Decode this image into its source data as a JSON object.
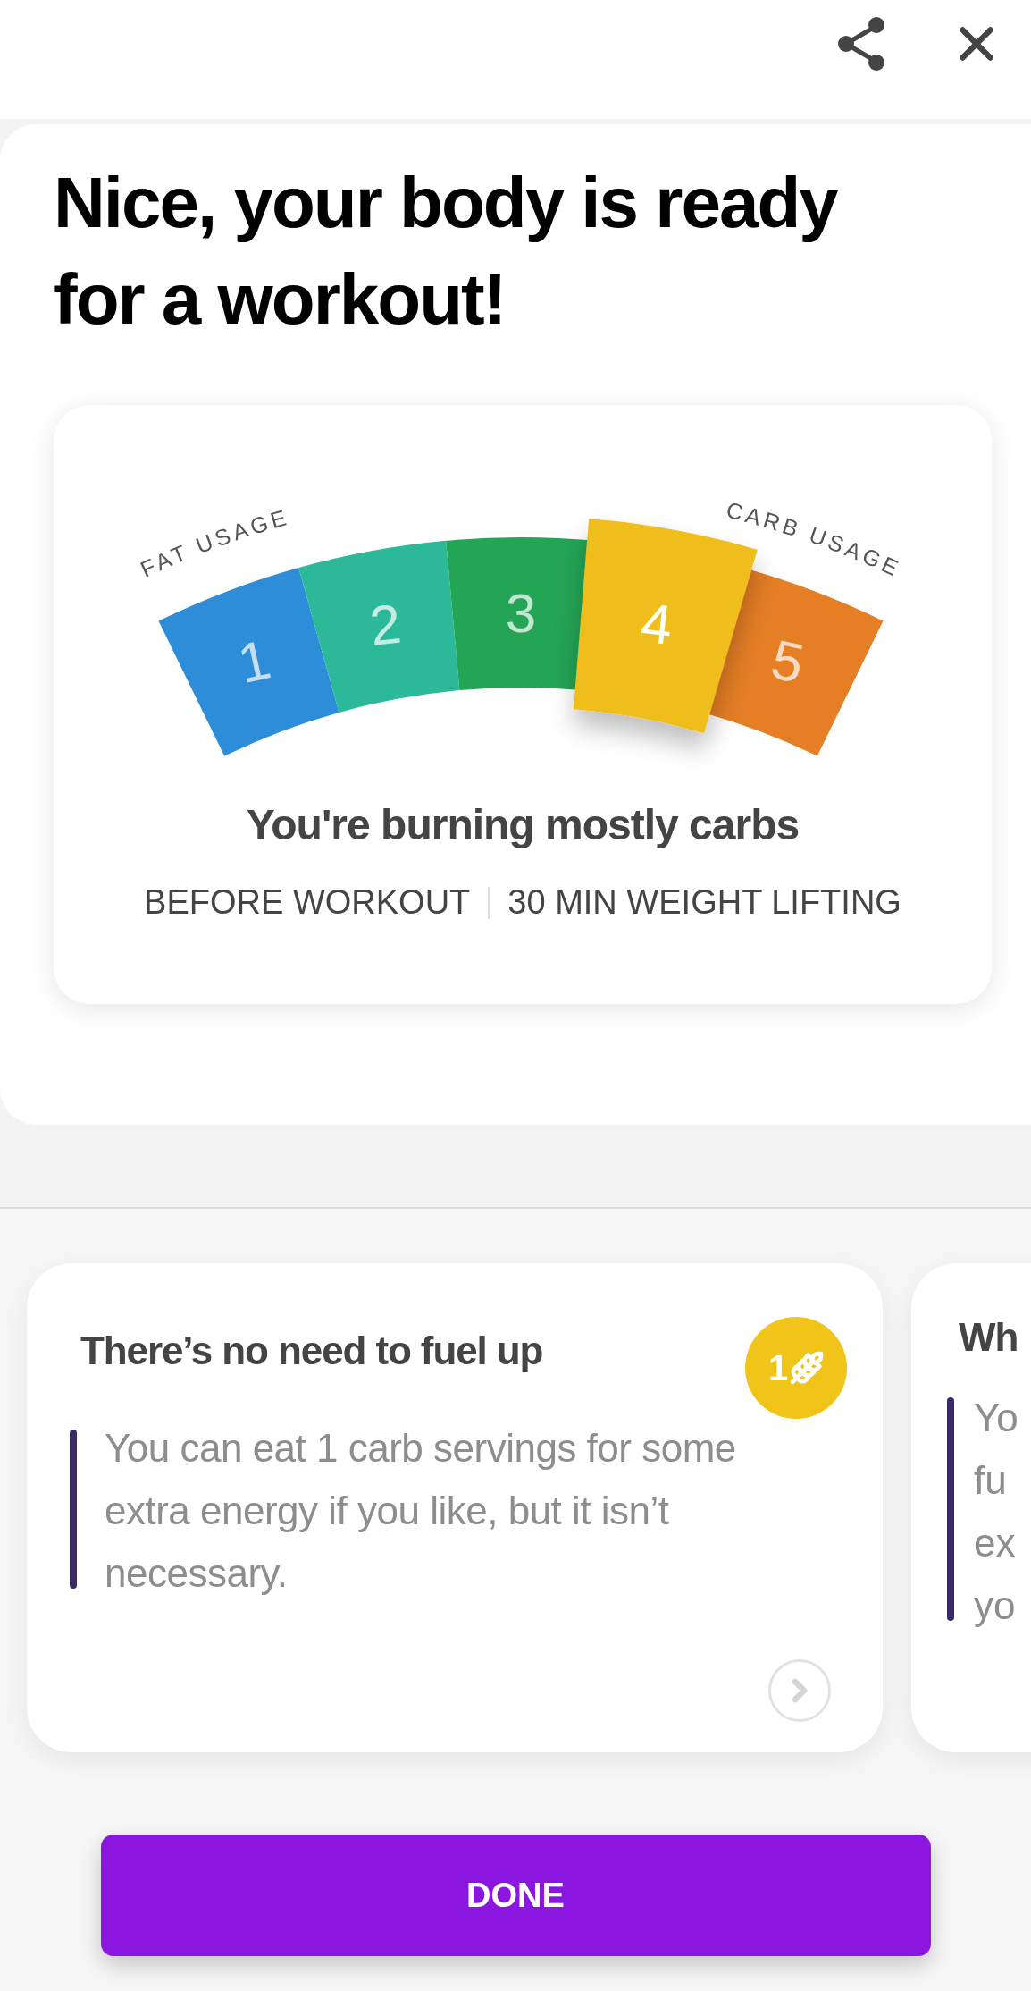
{
  "title": "Nice, your body is ready for a workout!",
  "gauge": {
    "left_label": "FAT USAGE",
    "right_label": "CARB USAGE",
    "segments": [
      {
        "label": "1",
        "color": "#2d8dd8",
        "selected": false
      },
      {
        "label": "2",
        "color": "#2bb99a",
        "selected": false
      },
      {
        "label": "3",
        "color": "#24a455",
        "selected": false
      },
      {
        "label": "4",
        "color": "#f0be1d",
        "selected": true
      },
      {
        "label": "5",
        "color": "#e57e25",
        "selected": false
      }
    ]
  },
  "result": {
    "headline": "You're burning mostly carbs",
    "context": [
      "BEFORE WORKOUT",
      "30 MIN WEIGHT LIFTING"
    ]
  },
  "tips": [
    {
      "kind": "full",
      "title": "There’s no need to fuel up",
      "badge": "1",
      "body": "You can eat 1 carb servings for some extra energy if you like, but it isn’t necessary."
    },
    {
      "kind": "partial",
      "title": "Wh",
      "body_lines": [
        "Yo",
        "fu",
        "ex",
        "yo"
      ]
    }
  ],
  "done_button": "DONE"
}
